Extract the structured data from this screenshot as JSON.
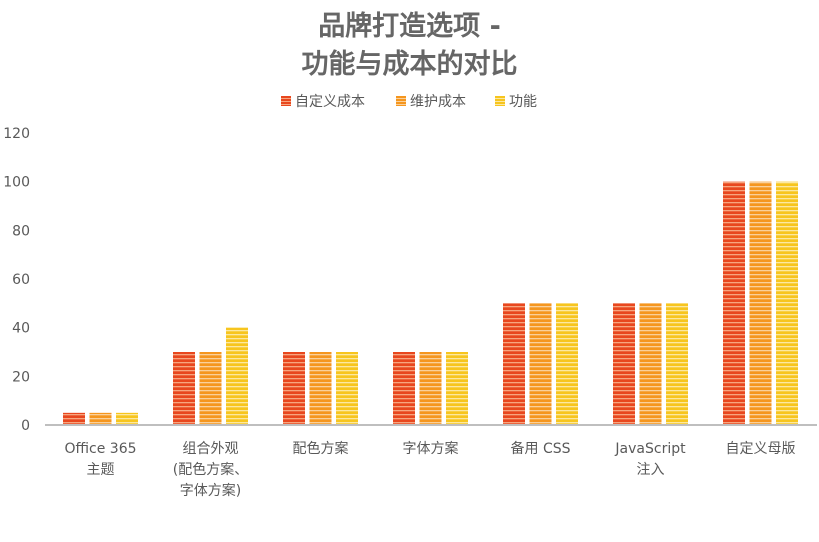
{
  "chart_data": {
    "type": "bar",
    "title": "品牌打造选项 -\n功能与成本的对比",
    "title_lines": [
      "品牌打造选项 -",
      "功能与成本的对比"
    ],
    "xlabel": "",
    "ylabel": "",
    "ylim": [
      0,
      120
    ],
    "yticks": [
      0,
      20,
      40,
      60,
      80,
      100,
      120
    ],
    "grid": false,
    "legend_position": "top",
    "categories": [
      [
        "Office 365",
        "主题"
      ],
      [
        "组合外观",
        "(配色方案、",
        "字体方案)"
      ],
      [
        "配色方案"
      ],
      [
        "字体方案"
      ],
      [
        "备用 CSS"
      ],
      [
        "JavaScript",
        "注入"
      ],
      [
        "自定义母版"
      ]
    ],
    "series": [
      {
        "name": "自定义成本",
        "color": "#E8471E",
        "stripe": "#F7A57F",
        "values": [
          5,
          30,
          30,
          30,
          50,
          50,
          100
        ]
      },
      {
        "name": "维护成本",
        "color": "#F5961E",
        "stripe": "#FAD09A",
        "values": [
          5,
          30,
          30,
          30,
          50,
          50,
          100
        ]
      },
      {
        "name": "功能",
        "color": "#F7C51E",
        "stripe": "#FCE8A0",
        "values": [
          5,
          40,
          30,
          30,
          50,
          50,
          100
        ]
      }
    ]
  }
}
